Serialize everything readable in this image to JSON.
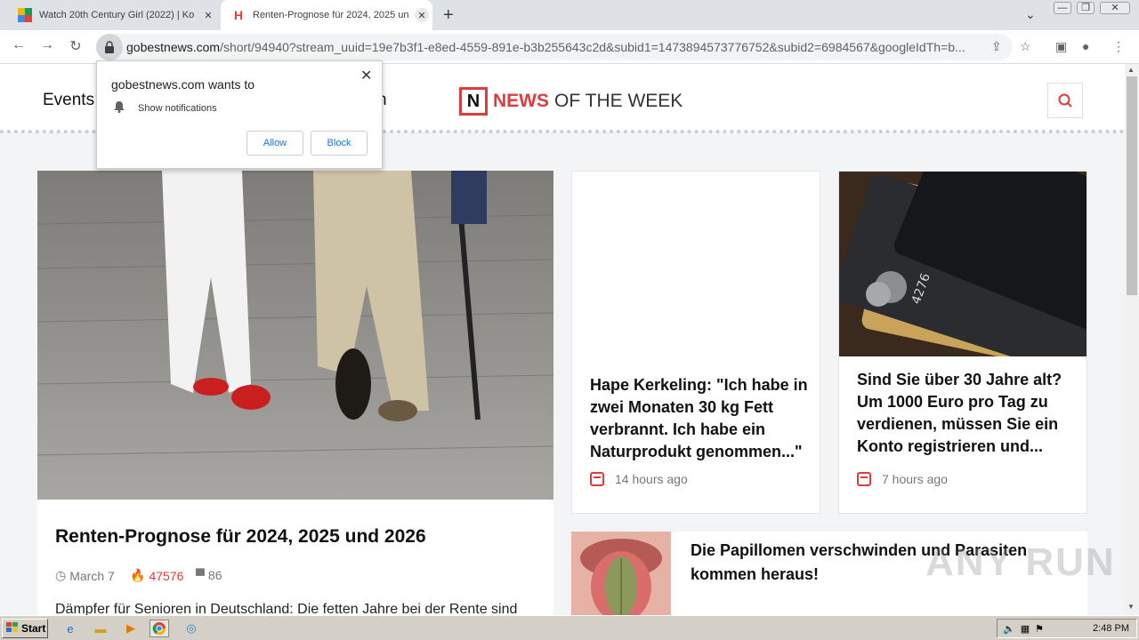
{
  "browser": {
    "tabs": [
      {
        "title": "Watch 20th Century Girl (2022) | Ko",
        "favicon": "colorful-favicon"
      },
      {
        "title": "Renten-Prognose für 2024, 2025 und",
        "favicon": "H"
      }
    ],
    "new_tab": "+",
    "url_host": "gobestnews.com",
    "url_rest": "/short/94940?stream_uuid=19e7b3f1-e8ed-4559-891e-b3b255643c2d&subid1=1473894573776752&subid2=6984567&googleIdTh=b...",
    "win_min": "—",
    "win_max": "❐",
    "win_close": "✕"
  },
  "site": {
    "nav": [
      "Events",
      "n"
    ],
    "logo_letter": "N",
    "logo_news": "NEWS",
    "logo_rest": "OF THE WEEK"
  },
  "hero": {
    "title": "Renten-Prognose für 2024, 2025 und 2026",
    "date": "March 7",
    "views": "47576",
    "comments": "86",
    "excerpt": "Dämpfer für Senioren in Deutschland: Die fetten Jahre bei der Rente sind"
  },
  "cards": [
    {
      "title": "Hape Kerkeling: \"Ich habe in zwei Monaten 30 kg Fett verbrannt. Ich habe ein Naturprodukt genommen...\"",
      "time": "14 hours ago"
    },
    {
      "title": "Sind Sie über 30 Jahre alt? Um 1000 Euro pro Tag zu verdienen, müssen Sie ein Konto registrieren und...",
      "time": "7 hours ago"
    }
  ],
  "wide_card": {
    "title": "Die Papillomen verschwinden und Parasiten kommen heraus!"
  },
  "popup": {
    "title": "gobestnews.com wants to",
    "permission": "Show notifications",
    "allow": "Allow",
    "block": "Block"
  },
  "watermark": "ANY RUN",
  "taskbar": {
    "start": "Start",
    "clock": "2:48 PM"
  },
  "colors": {
    "accent": "#e03b3b",
    "link": "#1a73e8"
  }
}
